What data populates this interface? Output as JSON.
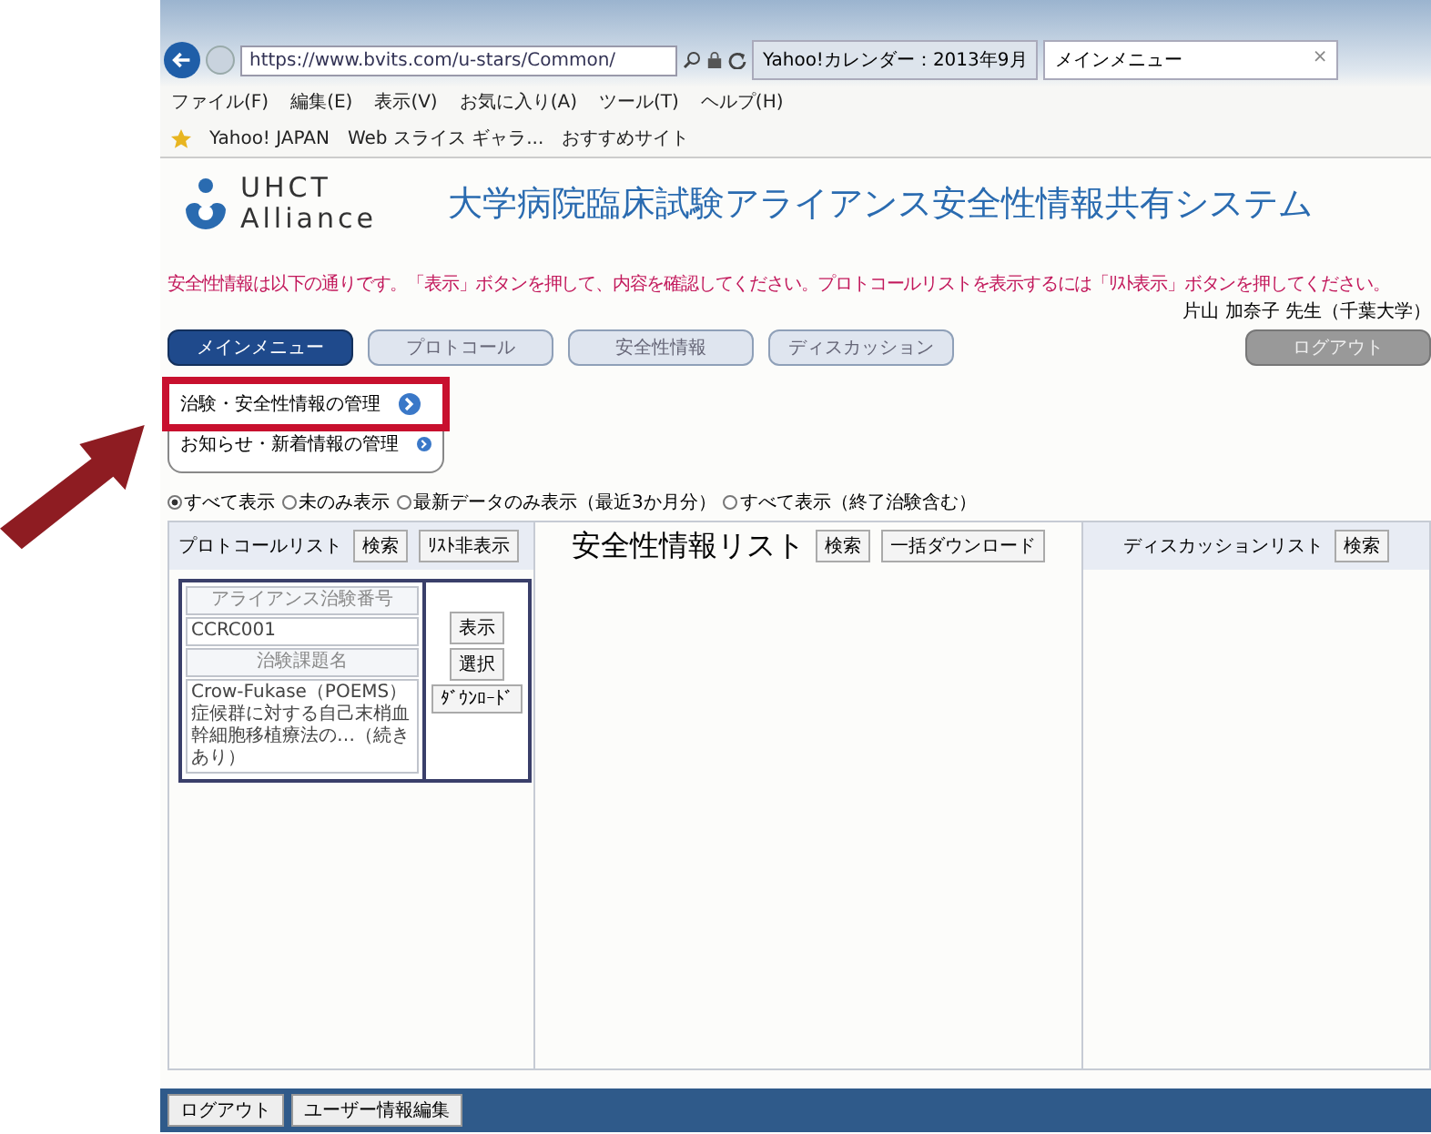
{
  "browser": {
    "url": "https://www.bvits.com/u-stars/Common/",
    "tabs": [
      {
        "label": "Yahoo!カレンダー：2013年9月",
        "selected": false
      },
      {
        "label": "メインメニュー",
        "selected": true
      }
    ],
    "close": "×",
    "menu": [
      "ファイル(F)",
      "編集(E)",
      "表示(V)",
      "お気に入り(A)",
      "ツール(T)",
      "ヘルプ(H)"
    ],
    "favorites": [
      "Yahoo! JAPAN",
      "Web スライス ギャラ...",
      "おすすめサイト"
    ]
  },
  "header": {
    "logo_line1": "UHCT",
    "logo_line2": "Alliance",
    "title": "大学病院臨床試験アライアンス安全性情報共有システム"
  },
  "notice": "安全性情報は以下の通りです。「表示」ボタンを押して、内容を確認してください。プロトコールリストを表示するには「ﾘｽﾄ表示」ボタンを押してください。",
  "user": "片山 加奈子 先生（千葉大学）",
  "nav": [
    {
      "label": "メインメニュー",
      "selected": true
    },
    {
      "label": "プロトコール",
      "selected": false
    },
    {
      "label": "安全性情報",
      "selected": false
    },
    {
      "label": "ディスカッション",
      "selected": false
    }
  ],
  "logout_top": "ログアウト",
  "dropdown": [
    {
      "label": "治験・安全性情報の管理",
      "highlighted": true
    },
    {
      "label": "お知らせ・新着情報の管理",
      "highlighted": false
    }
  ],
  "filters": [
    {
      "label": "すべて表示",
      "selected": true
    },
    {
      "label": "未のみ表示",
      "selected": false
    },
    {
      "label": "最新データのみ表示（最近3か月分）",
      "selected": false
    },
    {
      "label": "すべて表示（終了治験含む）",
      "selected": false
    }
  ],
  "panels": [
    {
      "title": "プロトコールリスト",
      "kind": "protocol",
      "buttons": [
        "検索",
        "ﾘｽﾄ非表示"
      ]
    },
    {
      "title": "安全性情報リスト",
      "kind": "safety",
      "buttons": [
        "検索",
        "一括ダウンロード"
      ]
    },
    {
      "title": "ディスカッションリスト",
      "kind": "discussion",
      "buttons": [
        "検索"
      ]
    }
  ],
  "protocol_card": {
    "number_label": "アライアンス治験番号",
    "number": "CCRC001",
    "name_label": "治験課題名",
    "name": "Crow-Fukase（POEMS）症候群に対する自己末梢血幹細胞移植療法の…（続きあり）",
    "buttons": [
      "表示",
      "選択",
      "ﾀﾞｳﾝﾛｰﾄﾞ"
    ]
  },
  "footer": [
    "ログアウト",
    "ユーザー情報編集"
  ]
}
